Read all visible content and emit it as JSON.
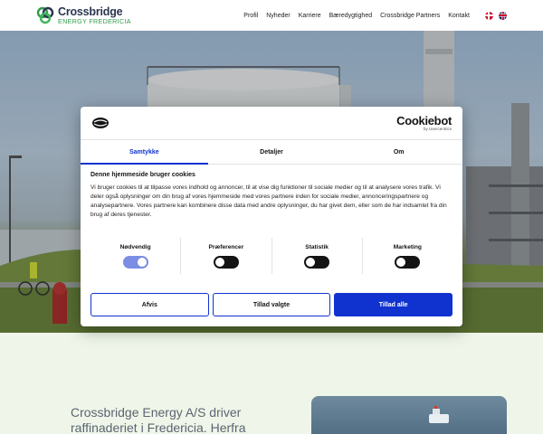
{
  "header": {
    "logo": {
      "line1": "Crossbridge",
      "line2": "ENERGY FREDERICIA"
    },
    "nav": [
      {
        "label": "Profil"
      },
      {
        "label": "Nyheder"
      },
      {
        "label": "Karriere"
      },
      {
        "label": "Bæredygtighed"
      },
      {
        "label": "Crossbridge Partners"
      },
      {
        "label": "Kontakt"
      }
    ],
    "languages": [
      "dk-flag-icon",
      "gb-flag-icon"
    ]
  },
  "cookie_dialog": {
    "brand": {
      "name": "Cookiebot",
      "sub": "by Usercentrics"
    },
    "tabs": [
      {
        "label": "Samtykke",
        "active": true
      },
      {
        "label": "Detaljer",
        "active": false
      },
      {
        "label": "Om",
        "active": false
      }
    ],
    "heading": "Denne hjemmeside bruger cookies",
    "body": "Vi bruger cookies til at tilpasse vores indhold og annoncer, til at vise dig funktioner til sociale medier og til at analysere vores trafik. Vi deler også oplysninger om din brug af vores hjemmeside med vores partnere inden for sociale medier, annonceringspartnere og analysepartnere. Vores partnere kan kombinere disse data med andre oplysninger, du har givet dem, eller som de har indsamlet fra din brug af deres tjenester.",
    "categories": [
      {
        "label": "Nødvendig",
        "enabled": true
      },
      {
        "label": "Præferencer",
        "enabled": false
      },
      {
        "label": "Statistik",
        "enabled": false
      },
      {
        "label": "Marketing",
        "enabled": false
      }
    ],
    "buttons": {
      "deny": "Afvis",
      "allow_selected": "Tillad valgte",
      "allow_all": "Tillad alle"
    },
    "accent_color": "#1032cf"
  },
  "lower": {
    "text": "Crossbridge Energy A/S driver raffinaderiet i Fredericia. Herfra leveres"
  }
}
